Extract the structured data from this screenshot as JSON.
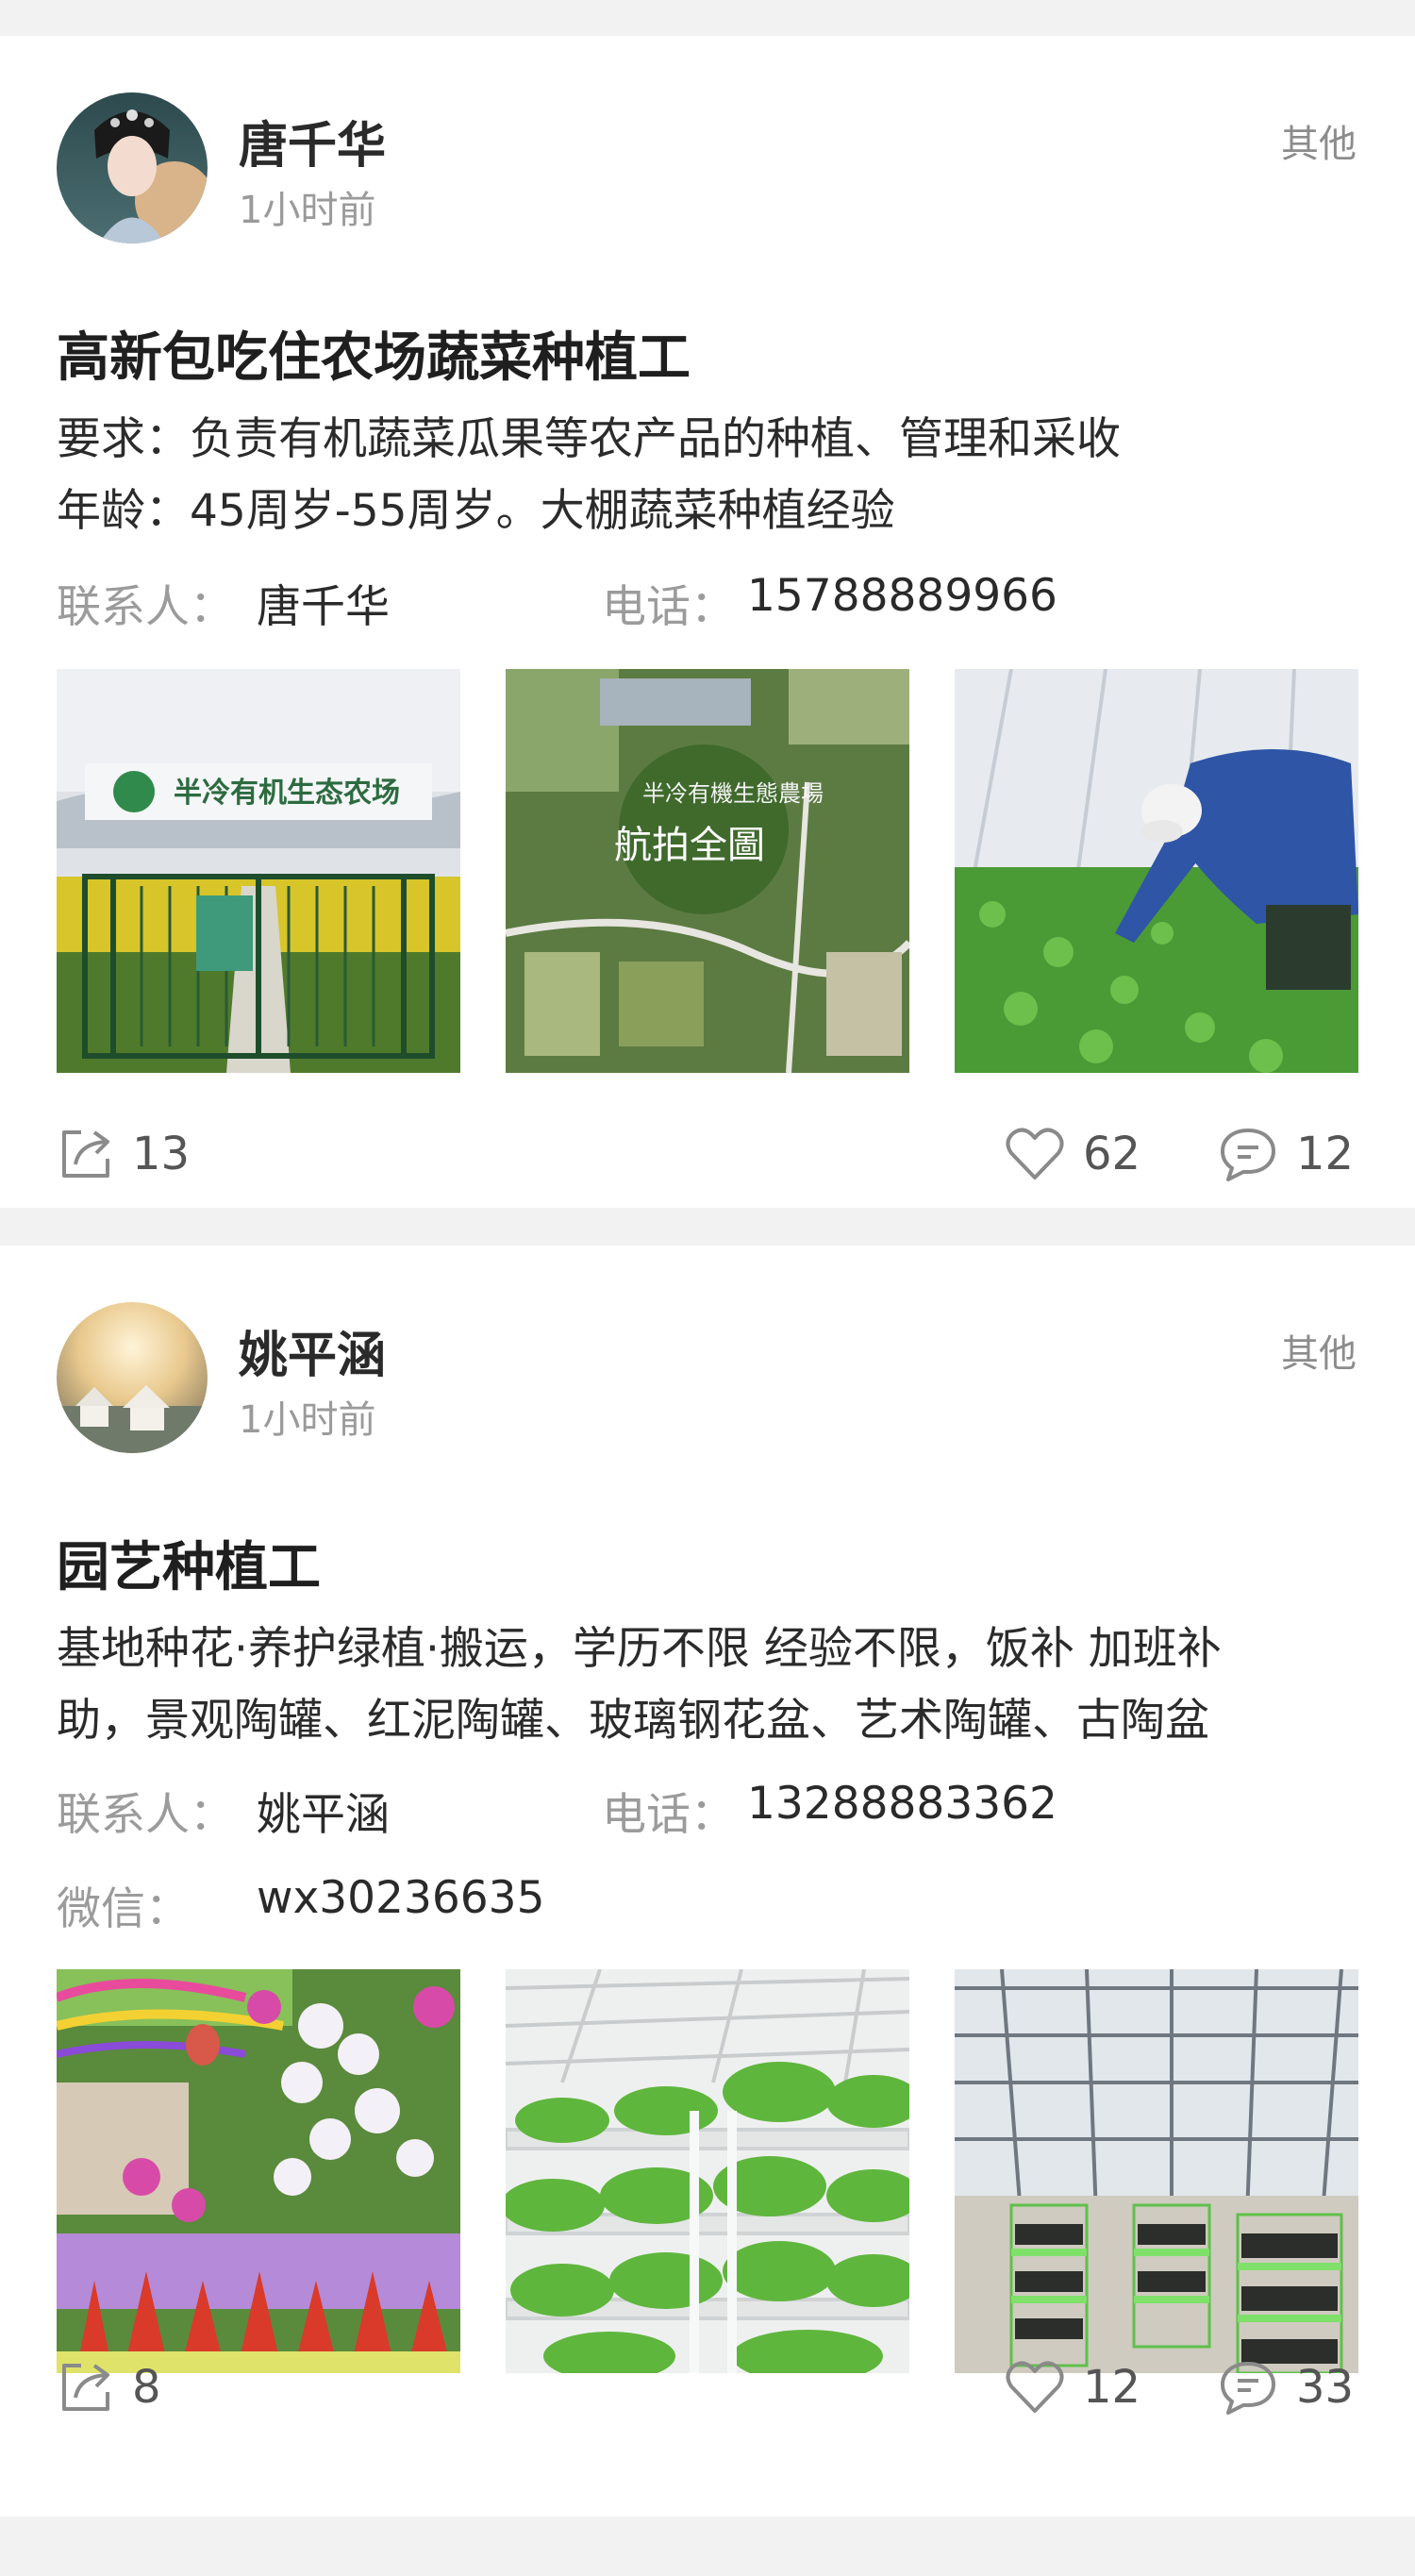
{
  "posts": [
    {
      "username": "唐千华",
      "time": "1小时前",
      "other": "其他",
      "title": "高新包吃住农场蔬菜种植工",
      "body": [
        "要求：负责有机蔬菜瓜果等农产品的种植、管理和采收",
        "年龄：45周岁-55周岁。大棚蔬菜种植经验"
      ],
      "contact_label": "联系人：",
      "contact_value": "唐千华",
      "phone_label": "电话：",
      "phone_value": "15788889966",
      "photos": [
        {
          "icon": "farm-gate-photo",
          "sign": "半冷有机生态农场"
        },
        {
          "icon": "aerial-farm-photo",
          "caption1": "半冷有機生態農場",
          "caption2": "航拍全圖"
        },
        {
          "icon": "worker-in-field-photo"
        }
      ],
      "share_count": "13",
      "like_count": "62",
      "comment_count": "12"
    },
    {
      "username": "姚平涵",
      "time": "1小时前",
      "other": "其他",
      "title": "园艺种植工",
      "body": [
        "基地种花·养护绿植·搬运，学历不限 经验不限，饭补 加班补",
        "助，景观陶罐、红泥陶罐、玻璃钢花盆、艺术陶罐、古陶盆"
      ],
      "contact_label": "联系人：",
      "contact_value": "姚平涵",
      "phone_label": "电话：",
      "phone_value": "13288883362",
      "wechat_label": "微信：",
      "wechat_value": "wx30236635",
      "photos": [
        {
          "icon": "flower-display-photo"
        },
        {
          "icon": "hydroponic-rack-photo"
        },
        {
          "icon": "greenhouse-interior-photo"
        }
      ],
      "share_count": "8",
      "like_count": "12",
      "comment_count": "33"
    }
  ],
  "colors": {
    "background": "#f2f2f2",
    "card": "#ffffff",
    "muted": "#9b9b9b",
    "text": "#2a2a2a"
  }
}
